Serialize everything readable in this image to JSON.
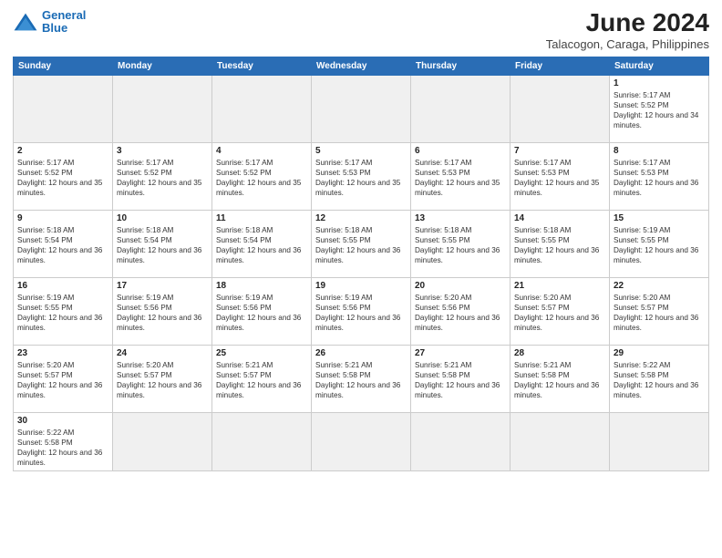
{
  "header": {
    "logo_text_general": "General",
    "logo_text_blue": "Blue",
    "month_title": "June 2024",
    "subtitle": "Talacogon, Caraga, Philippines"
  },
  "days_of_week": [
    "Sunday",
    "Monday",
    "Tuesday",
    "Wednesday",
    "Thursday",
    "Friday",
    "Saturday"
  ],
  "weeks": [
    [
      {
        "day": "",
        "empty": true
      },
      {
        "day": "",
        "empty": true
      },
      {
        "day": "",
        "empty": true
      },
      {
        "day": "",
        "empty": true
      },
      {
        "day": "",
        "empty": true
      },
      {
        "day": "",
        "empty": true
      },
      {
        "day": "1",
        "sunrise": "5:17 AM",
        "sunset": "5:52 PM",
        "daylight": "12 hours and 34 minutes."
      }
    ],
    [
      {
        "day": "2",
        "sunrise": "5:17 AM",
        "sunset": "5:52 PM",
        "daylight": "12 hours and 35 minutes."
      },
      {
        "day": "3",
        "sunrise": "5:17 AM",
        "sunset": "5:52 PM",
        "daylight": "12 hours and 35 minutes."
      },
      {
        "day": "4",
        "sunrise": "5:17 AM",
        "sunset": "5:52 PM",
        "daylight": "12 hours and 35 minutes."
      },
      {
        "day": "5",
        "sunrise": "5:17 AM",
        "sunset": "5:53 PM",
        "daylight": "12 hours and 35 minutes."
      },
      {
        "day": "6",
        "sunrise": "5:17 AM",
        "sunset": "5:53 PM",
        "daylight": "12 hours and 35 minutes."
      },
      {
        "day": "7",
        "sunrise": "5:17 AM",
        "sunset": "5:53 PM",
        "daylight": "12 hours and 35 minutes."
      },
      {
        "day": "8",
        "sunrise": "5:17 AM",
        "sunset": "5:53 PM",
        "daylight": "12 hours and 36 minutes."
      }
    ],
    [
      {
        "day": "9",
        "sunrise": "5:18 AM",
        "sunset": "5:54 PM",
        "daylight": "12 hours and 36 minutes."
      },
      {
        "day": "10",
        "sunrise": "5:18 AM",
        "sunset": "5:54 PM",
        "daylight": "12 hours and 36 minutes."
      },
      {
        "day": "11",
        "sunrise": "5:18 AM",
        "sunset": "5:54 PM",
        "daylight": "12 hours and 36 minutes."
      },
      {
        "day": "12",
        "sunrise": "5:18 AM",
        "sunset": "5:55 PM",
        "daylight": "12 hours and 36 minutes."
      },
      {
        "day": "13",
        "sunrise": "5:18 AM",
        "sunset": "5:55 PM",
        "daylight": "12 hours and 36 minutes."
      },
      {
        "day": "14",
        "sunrise": "5:18 AM",
        "sunset": "5:55 PM",
        "daylight": "12 hours and 36 minutes."
      },
      {
        "day": "15",
        "sunrise": "5:19 AM",
        "sunset": "5:55 PM",
        "daylight": "12 hours and 36 minutes."
      }
    ],
    [
      {
        "day": "16",
        "sunrise": "5:19 AM",
        "sunset": "5:55 PM",
        "daylight": "12 hours and 36 minutes."
      },
      {
        "day": "17",
        "sunrise": "5:19 AM",
        "sunset": "5:56 PM",
        "daylight": "12 hours and 36 minutes."
      },
      {
        "day": "18",
        "sunrise": "5:19 AM",
        "sunset": "5:56 PM",
        "daylight": "12 hours and 36 minutes."
      },
      {
        "day": "19",
        "sunrise": "5:19 AM",
        "sunset": "5:56 PM",
        "daylight": "12 hours and 36 minutes."
      },
      {
        "day": "20",
        "sunrise": "5:20 AM",
        "sunset": "5:56 PM",
        "daylight": "12 hours and 36 minutes."
      },
      {
        "day": "21",
        "sunrise": "5:20 AM",
        "sunset": "5:57 PM",
        "daylight": "12 hours and 36 minutes."
      },
      {
        "day": "22",
        "sunrise": "5:20 AM",
        "sunset": "5:57 PM",
        "daylight": "12 hours and 36 minutes."
      }
    ],
    [
      {
        "day": "23",
        "sunrise": "5:20 AM",
        "sunset": "5:57 PM",
        "daylight": "12 hours and 36 minutes."
      },
      {
        "day": "24",
        "sunrise": "5:20 AM",
        "sunset": "5:57 PM",
        "daylight": "12 hours and 36 minutes."
      },
      {
        "day": "25",
        "sunrise": "5:21 AM",
        "sunset": "5:57 PM",
        "daylight": "12 hours and 36 minutes."
      },
      {
        "day": "26",
        "sunrise": "5:21 AM",
        "sunset": "5:58 PM",
        "daylight": "12 hours and 36 minutes."
      },
      {
        "day": "27",
        "sunrise": "5:21 AM",
        "sunset": "5:58 PM",
        "daylight": "12 hours and 36 minutes."
      },
      {
        "day": "28",
        "sunrise": "5:21 AM",
        "sunset": "5:58 PM",
        "daylight": "12 hours and 36 minutes."
      },
      {
        "day": "29",
        "sunrise": "5:22 AM",
        "sunset": "5:58 PM",
        "daylight": "12 hours and 36 minutes."
      }
    ],
    [
      {
        "day": "30",
        "sunrise": "5:22 AM",
        "sunset": "5:58 PM",
        "daylight": "12 hours and 36 minutes."
      },
      {
        "day": "",
        "empty": true
      },
      {
        "day": "",
        "empty": true
      },
      {
        "day": "",
        "empty": true
      },
      {
        "day": "",
        "empty": true
      },
      {
        "day": "",
        "empty": true
      },
      {
        "day": "",
        "empty": true
      }
    ]
  ]
}
